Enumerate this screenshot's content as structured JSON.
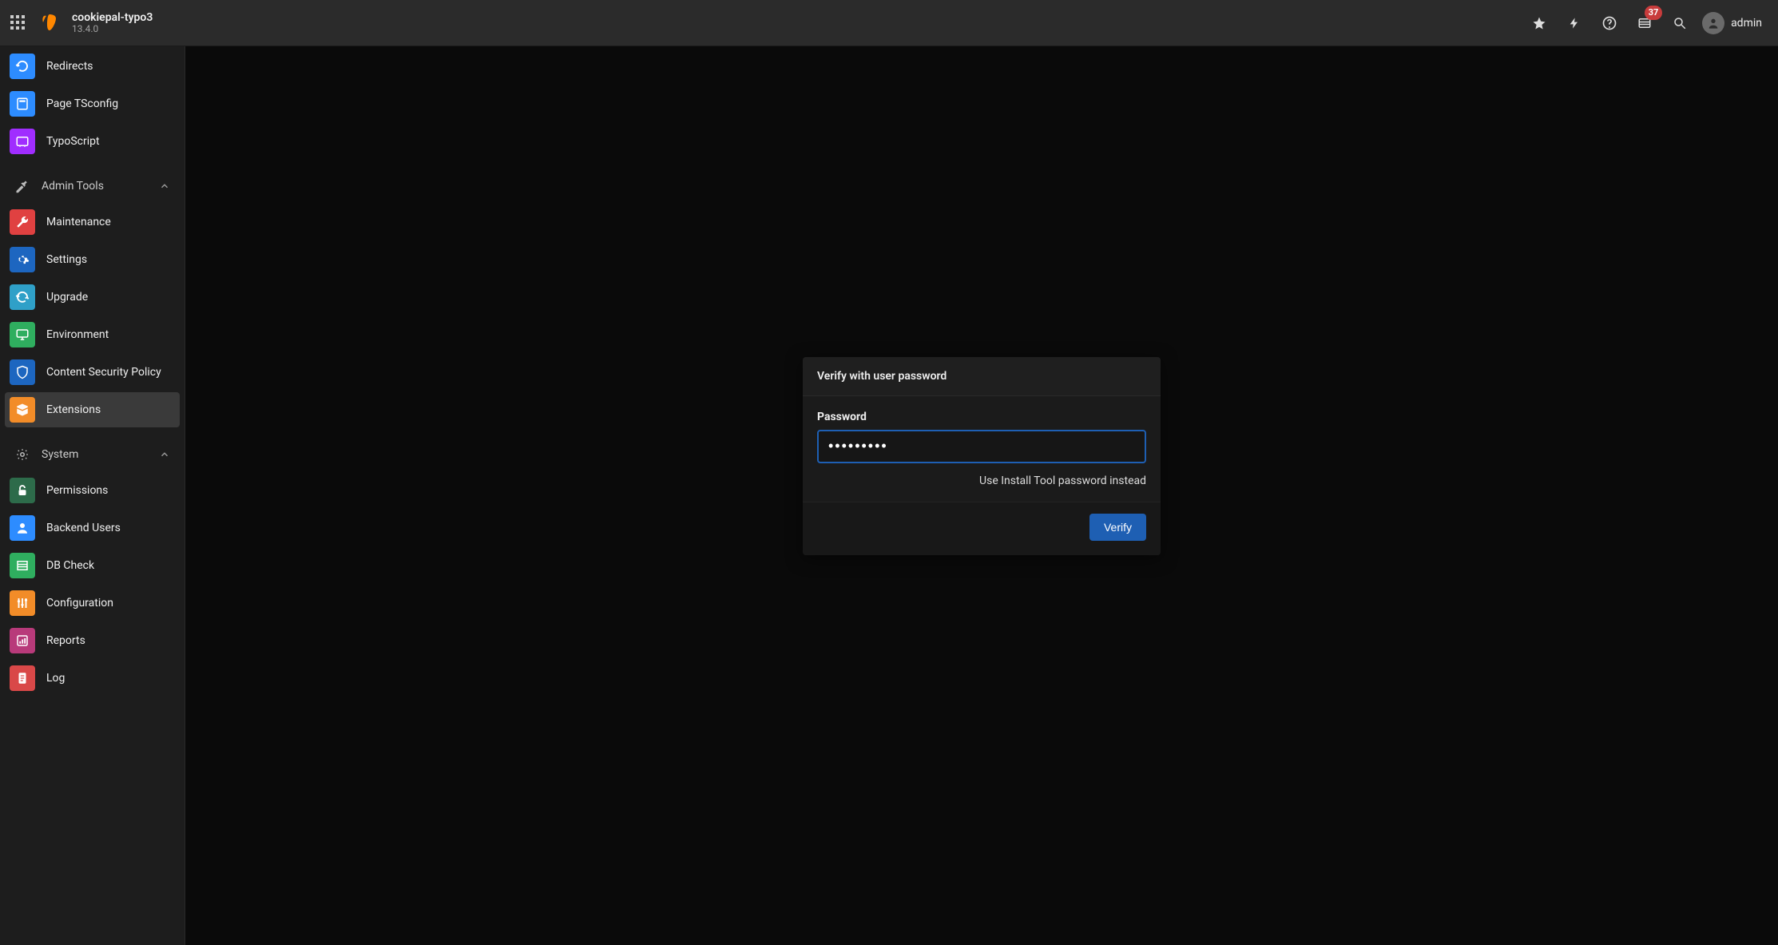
{
  "topbar": {
    "site_title": "cookiepal-typo3",
    "version": "13.4.0",
    "notifications_count": "37",
    "username": "admin"
  },
  "sidebar": {
    "items": [
      {
        "label": "Redirects",
        "icon_bg": "#2d8cff"
      },
      {
        "label": "Page TSconfig",
        "icon_bg": "#2d8cff"
      },
      {
        "label": "TypoScript",
        "icon_bg": "#a02dff"
      }
    ],
    "group_admin": {
      "label": "Admin Tools"
    },
    "admin_items": [
      {
        "label": "Maintenance",
        "icon_bg": "#e04141"
      },
      {
        "label": "Settings",
        "icon_bg": "#1d66c0"
      },
      {
        "label": "Upgrade",
        "icon_bg": "#2fa0c8"
      },
      {
        "label": "Environment",
        "icon_bg": "#2fae5f"
      },
      {
        "label": "Content Security Policy",
        "icon_bg": "#1d66c0"
      },
      {
        "label": "Extensions",
        "icon_bg": "#f28c28",
        "active": true
      }
    ],
    "group_system": {
      "label": "System"
    },
    "system_items": [
      {
        "label": "Permissions",
        "icon_bg": "#2d6b4a"
      },
      {
        "label": "Backend Users",
        "icon_bg": "#2d8cff"
      },
      {
        "label": "DB Check",
        "icon_bg": "#2fae5f"
      },
      {
        "label": "Configuration",
        "icon_bg": "#f28c28"
      },
      {
        "label": "Reports",
        "icon_bg": "#b83a7a"
      },
      {
        "label": "Log",
        "icon_bg": "#d94848"
      }
    ]
  },
  "verify": {
    "title": "Verify with user password",
    "field_label": "Password",
    "field_value": "•••••••••",
    "alt_link": "Use Install Tool password instead",
    "button": "Verify"
  }
}
